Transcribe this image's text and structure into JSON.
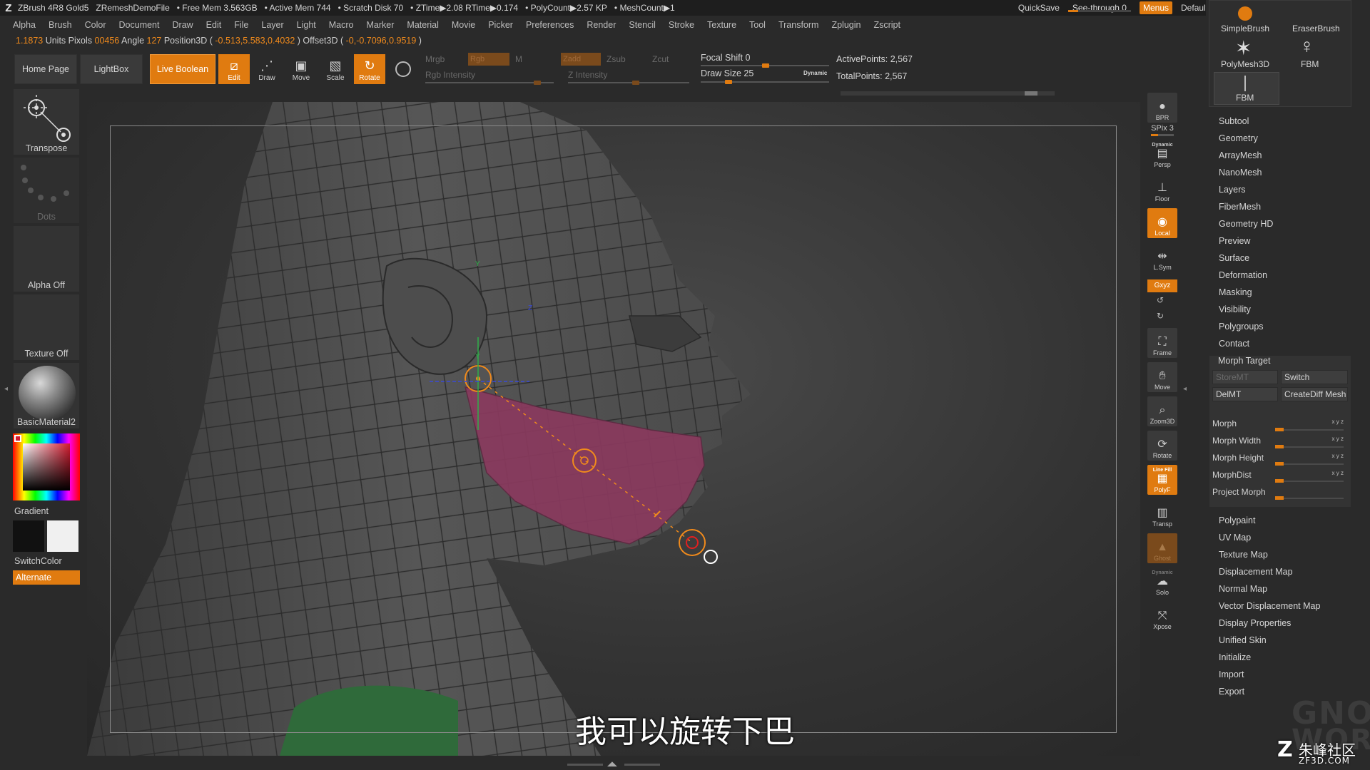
{
  "titlebar": {
    "app": "ZBrush 4R8 Gold5",
    "file": "ZRemeshDemoFile",
    "free_mem": "• Free Mem 3.563GB",
    "active_mem": "• Active Mem 744",
    "scratch": "• Scratch Disk 70",
    "ztime": "• ZTime▶2.08 RTime▶0.174",
    "polycount": "• PolyCount▶2.57 KP",
    "meshcount": "• MeshCount▶1",
    "quicksave": "QuickSave",
    "see_through": "See-through  0",
    "menus": "Menus",
    "script": "DefaultZScript"
  },
  "menubar": [
    "Alpha",
    "Brush",
    "Color",
    "Document",
    "Draw",
    "Edit",
    "File",
    "Layer",
    "Light",
    "Macro",
    "Marker",
    "Material",
    "Movie",
    "Picker",
    "Preferences",
    "Render",
    "Stencil",
    "Stroke",
    "Texture",
    "Tool",
    "Transform",
    "Zplugin",
    "Zscript"
  ],
  "infoline": {
    "units": "1.1873",
    "units_label": " Units",
    "pixols_label": "Pixols ",
    "pixols": "00456",
    "angle_label": " Angle ",
    "angle": "127",
    "pos_label": " Position3D ( ",
    "pos": "-0.513,5.583,0.4032",
    "offset_label": " ) Offset3D ( ",
    "offset": "-0,-0.7096,0.9519",
    "end": " )"
  },
  "toolbar": {
    "home": "Home Page",
    "lightbox": "LightBox",
    "live_boolean": "Live Boolean",
    "edit": "Edit",
    "draw": "Draw",
    "move": "Move",
    "scale": "Scale",
    "rotate": "Rotate",
    "mrgb": "Mrgb",
    "rgb": "Rgb",
    "m": "M",
    "zadd": "Zadd",
    "zsub": "Zsub",
    "zcut": "Zcut",
    "rgb_intensity": "Rgb Intensity",
    "z_intensity": "Z Intensity",
    "focal_shift": "Focal Shift 0",
    "draw_size": "Draw Size 25",
    "dynamic": "Dynamic",
    "active_points": "ActivePoints: 2,567",
    "total_points": "TotalPoints: 2,567"
  },
  "leftshelf": {
    "transpose": "Transpose",
    "dots": "Dots",
    "alpha": "Alpha Off",
    "texture": "Texture Off",
    "material": "BasicMaterial2",
    "gradient": "Gradient",
    "switchcolor": "SwitchColor",
    "alternate": "Alternate"
  },
  "rightstrip": {
    "bpr": "BPR",
    "spix": "SPix 3",
    "dynamic": "Dynamic",
    "persp": "Persp",
    "floor": "Floor",
    "local": "Local",
    "lsym": "L.Sym",
    "xyz": "Gxyz",
    "frame": "Frame",
    "move": "Move",
    "zoom3d": "Zoom3D",
    "rotate": "Rotate",
    "linefill": "Line Fill",
    "polyf": "PolyF",
    "transp": "Transp",
    "ghost": "Ghost",
    "solo_dynamic": "Dynamic",
    "solo": "Solo",
    "xpose": "Xpose"
  },
  "rightpanel": {
    "brushes": [
      "SimpleBrush",
      "EraserBrush",
      "PolyMesh3D",
      "FBM",
      "FBM"
    ],
    "items_top": [
      "Subtool",
      "Geometry",
      "ArrayMesh",
      "NanoMesh",
      "Layers",
      "FiberMesh",
      "Geometry HD",
      "Preview",
      "Surface",
      "Deformation",
      "Masking",
      "Visibility",
      "Polygroups",
      "Contact"
    ],
    "morph_target": "Morph Target",
    "storemt": "StoreMT",
    "switch": "Switch",
    "delmt": "DelMT",
    "creatediff": "CreateDiff Mesh",
    "sliders": [
      "Morph",
      "Morph Width",
      "Morph Height",
      "MorphDist",
      "Project Morph"
    ],
    "axes": "x y z",
    "items_bottom": [
      "Polypaint",
      "UV Map",
      "Texture Map",
      "Displacement Map",
      "Normal Map",
      "Vector Displacement Map",
      "Display Properties",
      "Unified Skin",
      "Initialize",
      "Import",
      "Export"
    ]
  },
  "viewport": {
    "gizmo_y": "Y",
    "gizmo_z": "Z"
  },
  "subtitle": "我可以旋转下巴",
  "watermark": {
    "gnomon": "GNOMON",
    "workshop": "WORKSHOP",
    "zf3d_cn": "朱峰社区",
    "zf3d": "ZF3D.COM"
  }
}
